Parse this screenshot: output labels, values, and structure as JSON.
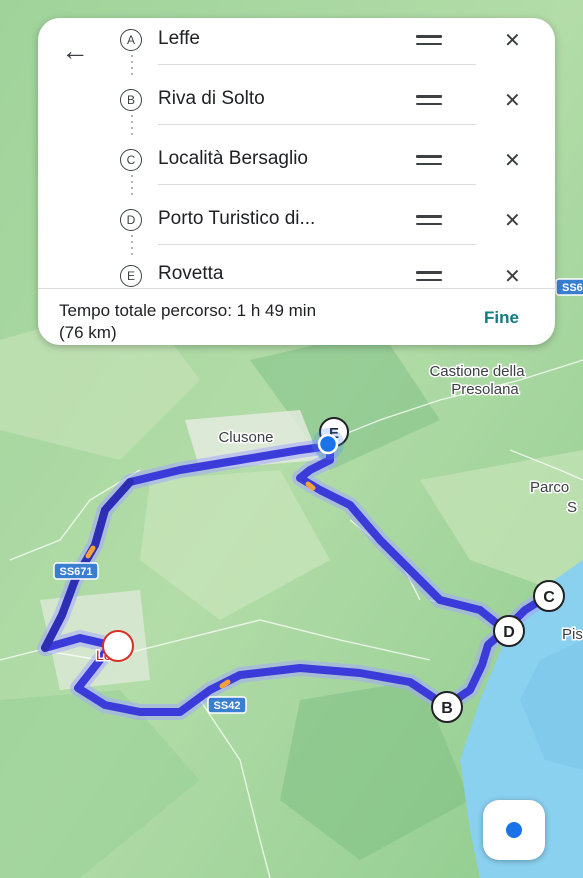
{
  "colors": {
    "route": "#3b3bd9",
    "route_glow": "#9aa0ff",
    "water": "#8ad0ef",
    "land": "#a8d8a0",
    "accent": "#137a7f"
  },
  "waypoints": [
    {
      "letter": "A",
      "name": "Leffe"
    },
    {
      "letter": "B",
      "name": "Riva di Solto"
    },
    {
      "letter": "C",
      "name": "Località Bersaglio"
    },
    {
      "letter": "D",
      "name": "Porto Turistico di..."
    },
    {
      "letter": "E",
      "name": "Rovetta"
    }
  ],
  "summary": {
    "text": "Tempo totale percorso: 1 h 49 min",
    "distance": "(76 km)",
    "done_label": "Fine"
  },
  "map_labels": {
    "castione_1": "Castione della",
    "castione_2": "Presolana",
    "clusone": "Clusone",
    "parco_1": "Parco",
    "parco_2": "S",
    "pis": "Pis",
    "leffe": "Leffe",
    "ss671": "SS671",
    "ss42": "SS42",
    "ss_top": "SS6"
  },
  "markers": {
    "b": "B",
    "c": "C",
    "d": "D",
    "e": "E"
  },
  "icons": {
    "back": "arrow-left-icon",
    "drag": "drag-handle-icon",
    "remove": "close-icon",
    "location": "my-location-icon"
  }
}
